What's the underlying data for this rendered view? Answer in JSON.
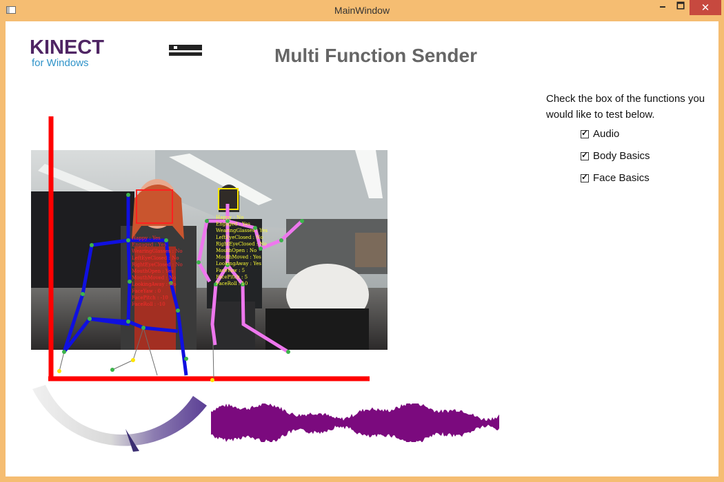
{
  "window": {
    "title": "MainWindow",
    "minimize": "🗕",
    "maximize": "🗖",
    "close": "✕"
  },
  "logo": {
    "main": "KINECT",
    "sub": "for Windows"
  },
  "heading": "Multi Function Sender",
  "instructions": "Check the box of the functions you would like to test below.",
  "functions": [
    {
      "label": "Audio",
      "checked": true
    },
    {
      "label": "Body Basics",
      "checked": true
    },
    {
      "label": "Face Basics",
      "checked": true
    }
  ],
  "face_stats": {
    "person1": [
      "Happy : Yes",
      "Engaged : Yes",
      "WearingGlasses : No",
      "LeftEyeClosed : No",
      "RightEyeClosed : No",
      "MouthOpen : Yes",
      "MouthMoved : No",
      "LookingAway : No",
      "FaceYaw : 0",
      "FacePitch : -10",
      "FaceRoll : -10"
    ],
    "person2": [
      "Happy : No",
      "Engaged : Yes",
      "WearingGlasses : Yes",
      "LeftEyeClosed : No",
      "RightEyeClosed : No",
      "MouthOpen : No",
      "MouthMoved : Yes",
      "LookingAway : Yes",
      "FaceYaw : 5",
      "FacePitch : 5",
      "FaceRoll : 10"
    ]
  },
  "colors": {
    "axis": "#ff0000",
    "skeleton1": "#1010e0",
    "skeleton2": "#ee77ee",
    "joint": "#3cb44b",
    "wave": "#7b0a7e",
    "titlebar": "#f5bd72",
    "close": "#c7493f"
  }
}
